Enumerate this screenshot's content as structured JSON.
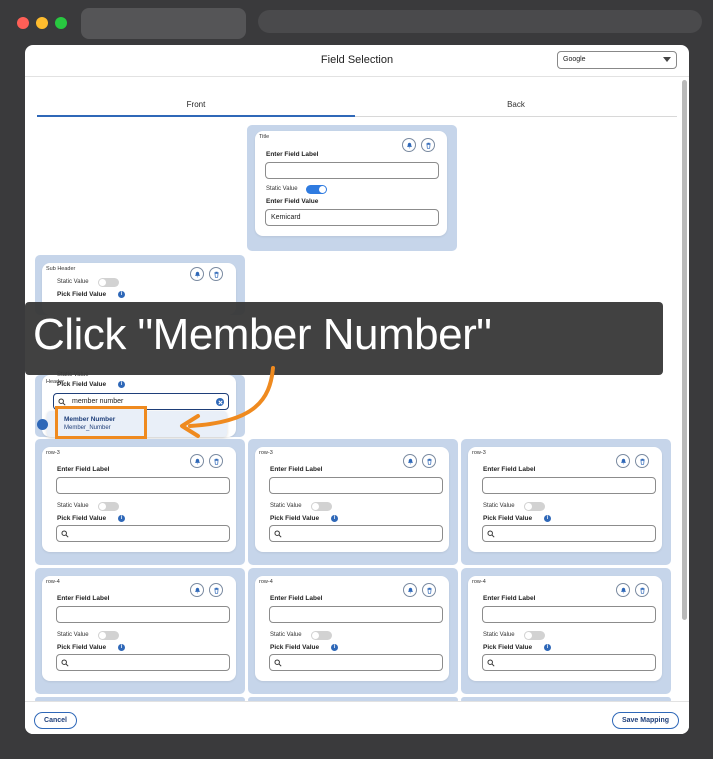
{
  "modal": {
    "title": "Field Selection",
    "source_selected": "Google",
    "tabs": {
      "front": "Front",
      "back": "Back"
    }
  },
  "common": {
    "enter_field_label": "Enter Field Label",
    "enter_field_value": "Enter Field Value",
    "static_value": "Static Value",
    "pick_field_value": "Pick Field Value",
    "info_glyph": "i"
  },
  "cards": {
    "title": {
      "label": "Title",
      "static_value_on": true,
      "field_value": "Kemicard"
    },
    "subheader": {
      "label": "Sub Header"
    },
    "header": {
      "label": "Header",
      "search_value": "member number"
    },
    "row3": {
      "label": "row-3"
    },
    "row4": {
      "label": "row-4"
    }
  },
  "dropdown": {
    "option_title": "Member Number",
    "option_sub": "Member_Number"
  },
  "footer": {
    "cancel": "Cancel",
    "save": "Save Mapping"
  },
  "callout": {
    "text": "Click \"Member Number\""
  },
  "colors": {
    "accent": "#2f68b8",
    "highlight": "#ef8a1f",
    "slot": "#c6d5ea"
  }
}
